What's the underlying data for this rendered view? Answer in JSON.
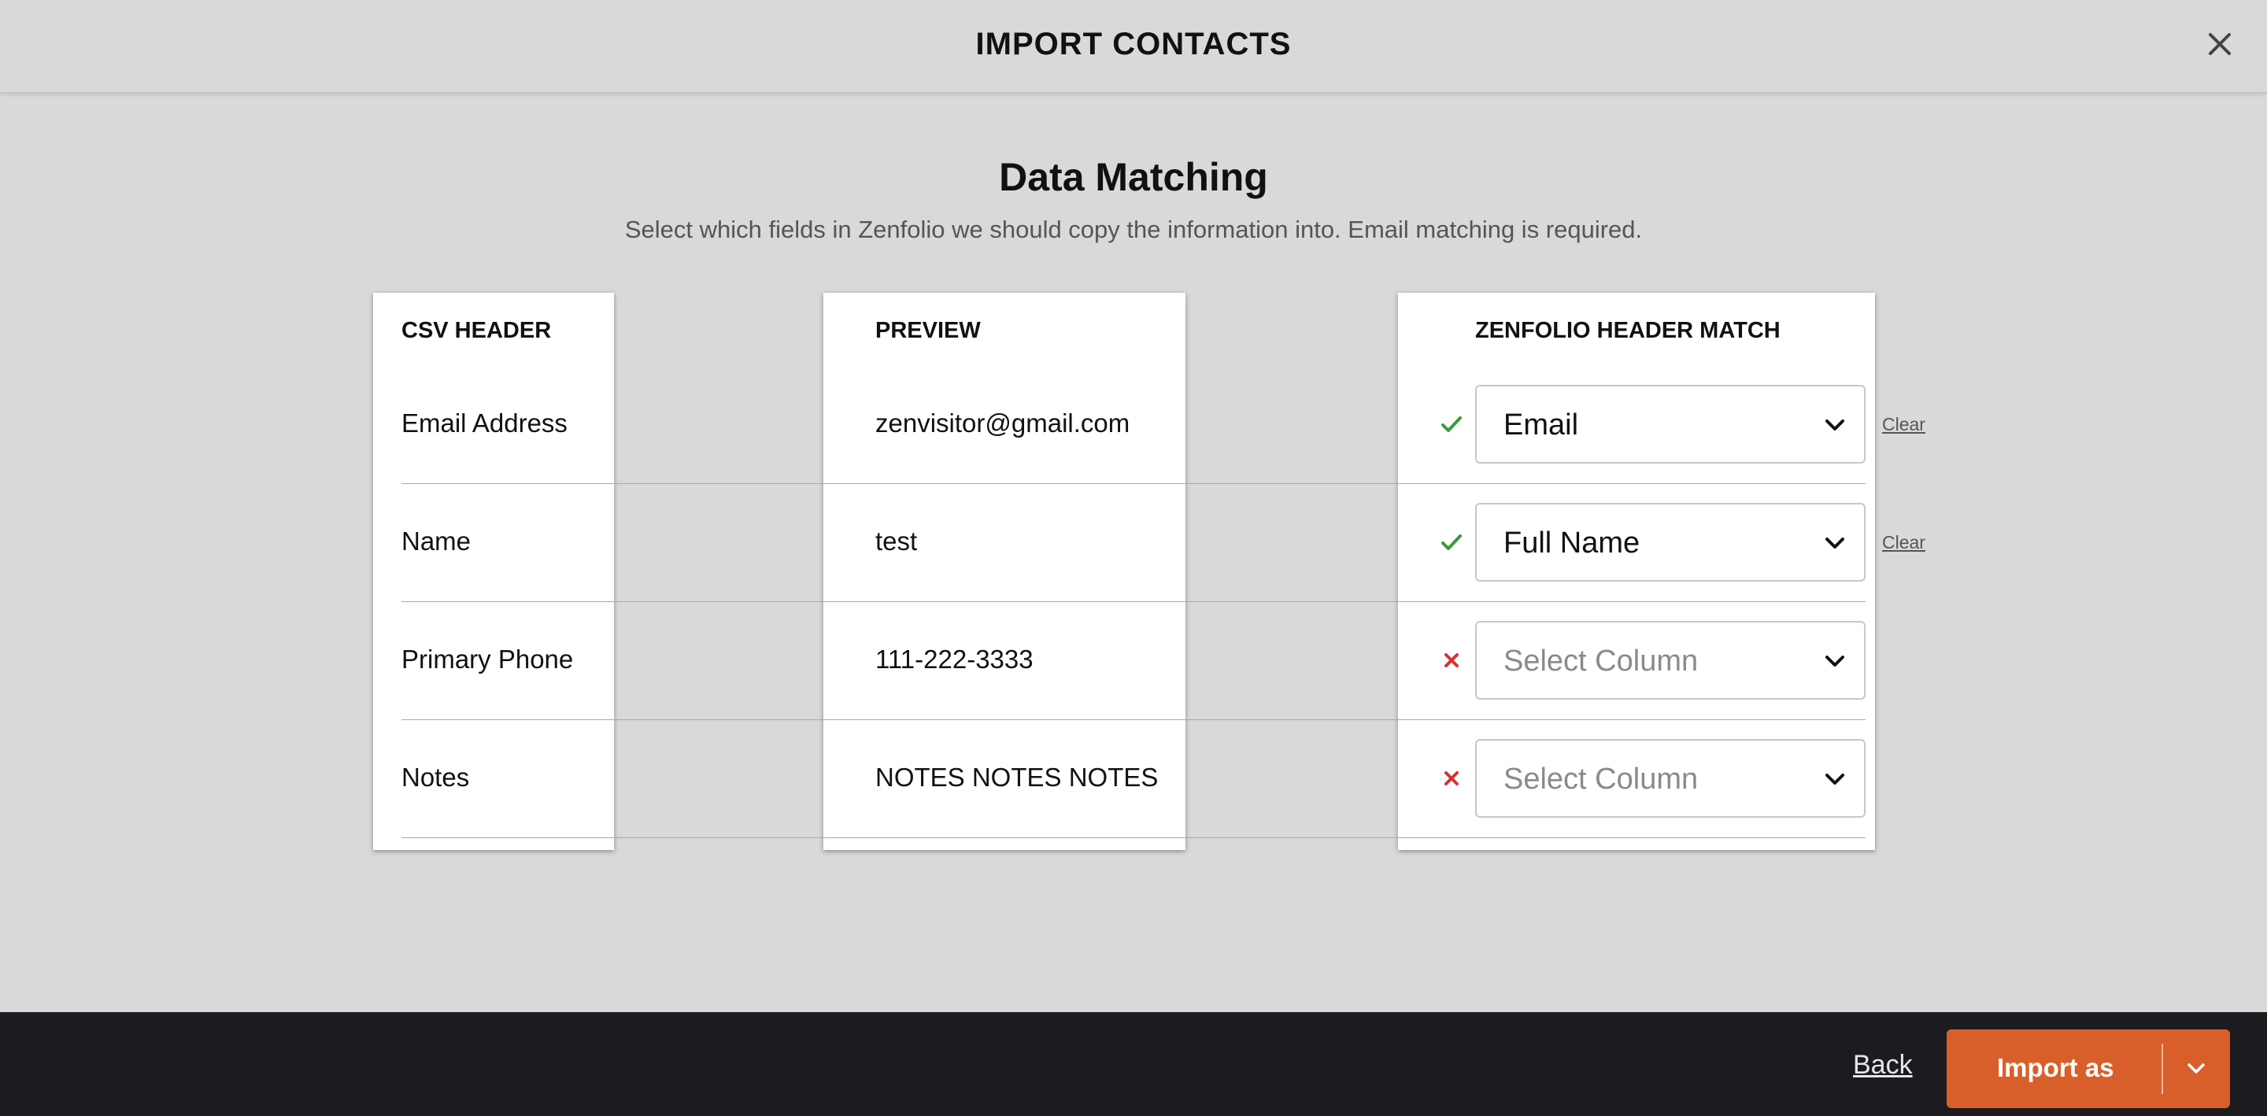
{
  "dialog": {
    "title": "IMPORT CONTACTS"
  },
  "section": {
    "title": "Data Matching",
    "subtitle": "Select which fields in Zenfolio we should copy the information into. Email matching is required."
  },
  "columns": {
    "csv_header": "CSV HEADER",
    "preview": "PREVIEW",
    "zenfolio_match": "ZENFOLIO HEADER MATCH"
  },
  "rows": [
    {
      "csv": "Email Address",
      "preview": "zenvisitor@gmail.com",
      "status": "matched",
      "match": "Email",
      "clear": "Clear"
    },
    {
      "csv": "Name",
      "preview": "test",
      "status": "matched",
      "match": "Full Name",
      "clear": "Clear"
    },
    {
      "csv": "Primary Phone",
      "preview": "111-222-3333",
      "status": "unmatched",
      "match_placeholder": "Select Column"
    },
    {
      "csv": "Notes",
      "preview": "NOTES NOTES NOTES",
      "status": "unmatched",
      "match_placeholder": "Select Column"
    }
  ],
  "footer": {
    "back_label": "Back",
    "import_label": "Import as"
  },
  "colors": {
    "accent": "#d85f2a",
    "matched": "#3a9a3a",
    "unmatched": "#d93030",
    "footer_bg": "#1c1c20",
    "page_bg": "#d9d9d9"
  },
  "icons": {
    "close": "close-icon",
    "matched": "check-icon",
    "unmatched": "x-icon",
    "dropdown": "chevron-down-icon"
  }
}
